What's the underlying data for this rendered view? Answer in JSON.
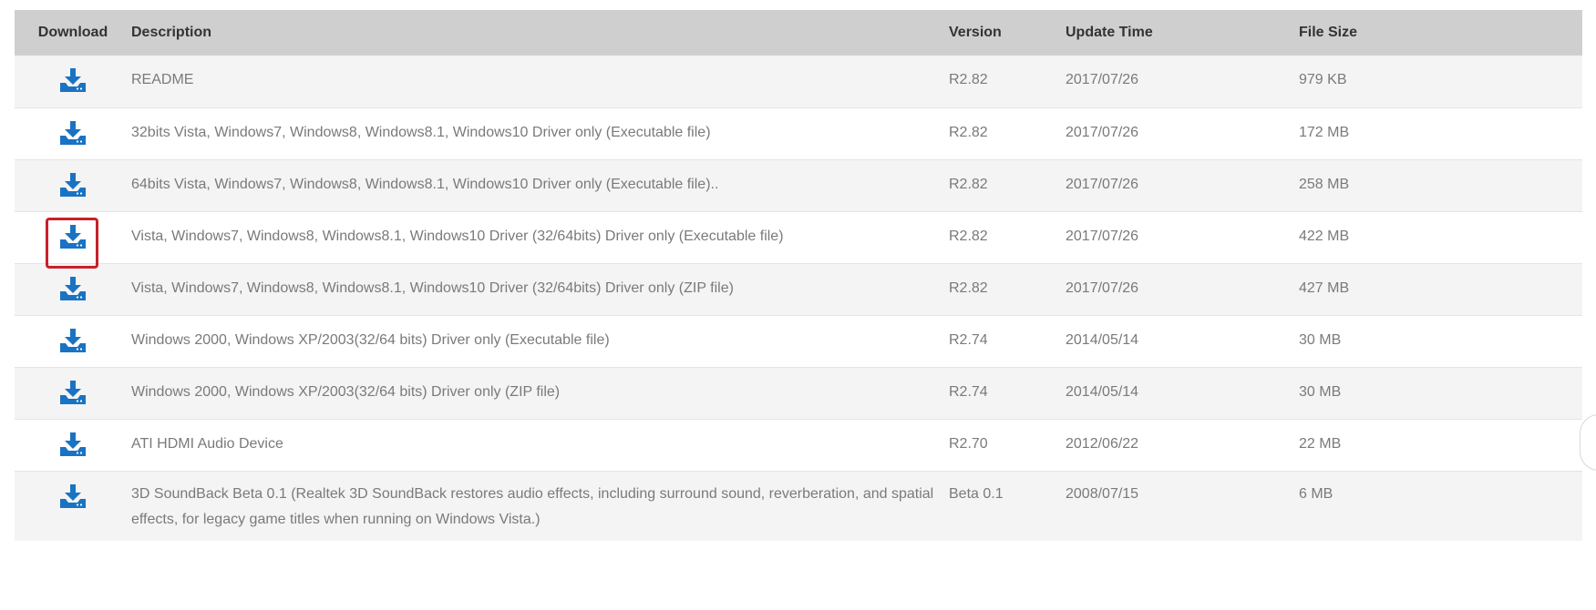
{
  "table": {
    "headers": {
      "download": "Download",
      "description": "Description",
      "version": "Version",
      "update_time": "Update Time",
      "file_size": "File Size"
    },
    "rows": [
      {
        "description": "README",
        "version": "R2.82",
        "update_time": "2017/07/26",
        "file_size": "979 KB"
      },
      {
        "description": "32bits Vista, Windows7, Windows8, Windows8.1, Windows10 Driver only (Executable file)",
        "version": "R2.82",
        "update_time": "2017/07/26",
        "file_size": "172 MB"
      },
      {
        "description": "64bits Vista, Windows7, Windows8, Windows8.1, Windows10 Driver only (Executable file)..",
        "version": "R2.82",
        "update_time": "2017/07/26",
        "file_size": "258 MB"
      },
      {
        "description": "Vista, Windows7, Windows8, Windows8.1, Windows10 Driver (32/64bits) Driver only (Executable file)",
        "version": "R2.82",
        "update_time": "2017/07/26",
        "file_size": "422 MB",
        "highlighted": true
      },
      {
        "description": "Vista, Windows7, Windows8, Windows8.1, Windows10 Driver (32/64bits) Driver only (ZIP file)",
        "version": "R2.82",
        "update_time": "2017/07/26",
        "file_size": "427 MB"
      },
      {
        "description": "Windows 2000, Windows XP/2003(32/64 bits) Driver only (Executable file)",
        "version": "R2.74",
        "update_time": "2014/05/14",
        "file_size": "30 MB"
      },
      {
        "description": "Windows 2000, Windows XP/2003(32/64 bits) Driver only (ZIP file)",
        "version": "R2.74",
        "update_time": "2014/05/14",
        "file_size": "30 MB"
      },
      {
        "description": "ATI HDMI Audio Device",
        "version": "R2.70",
        "update_time": "2012/06/22",
        "file_size": "22 MB"
      },
      {
        "description": "3D SoundBack Beta 0.1 (Realtek 3D SoundBack restores audio effects, including surround sound, reverberation, and spatial effects, for legacy game titles when running on Windows Vista.)",
        "version": "Beta 0.1",
        "update_time": "2008/07/15",
        "file_size": "6 MB"
      }
    ]
  },
  "icons": {
    "download": "download-icon"
  },
  "colors": {
    "header_bg": "#cfcfcf",
    "icon_blue": "#1a73c2",
    "highlight_red": "#c8202a",
    "text_gray": "#7a7a7a"
  }
}
